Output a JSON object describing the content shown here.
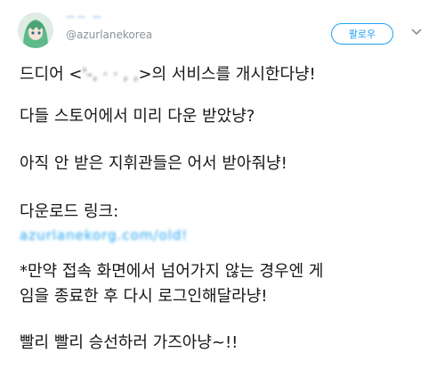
{
  "tweet": {
    "display_name": "ㅡㅡ ㅡ",
    "handle": "@azurlanekorea",
    "follow_label": "팔로우",
    "line1_prefix": "드디어 <",
    "line1_blurred": "'-, ·  ·   ,   ,",
    "line1_suffix": ">의 서비스를 개시한다냥!",
    "line2": "다들 스토어에서 미리 다운 받았냥?",
    "line3": "아직 안 받은 지휘관들은 어서 받아줘냥!",
    "line4": "다운로드 링크:",
    "link_blurred": "azurlanekorg.com/old!",
    "line5a": "*만약 접속 화면에서 넘어가지 않는 경우엔 게",
    "line5b": "임을 종료한 후 다시 로그인해달라냥!",
    "line6": "빨리 빨리 승선하러 가즈아냥~!!"
  },
  "icons": {
    "avatar": "anime-character-avatar-icon",
    "chevron": "chevron-down-icon"
  },
  "colors": {
    "accent": "#1da1f2",
    "handle": "#8a9199",
    "text": "#14171a"
  }
}
